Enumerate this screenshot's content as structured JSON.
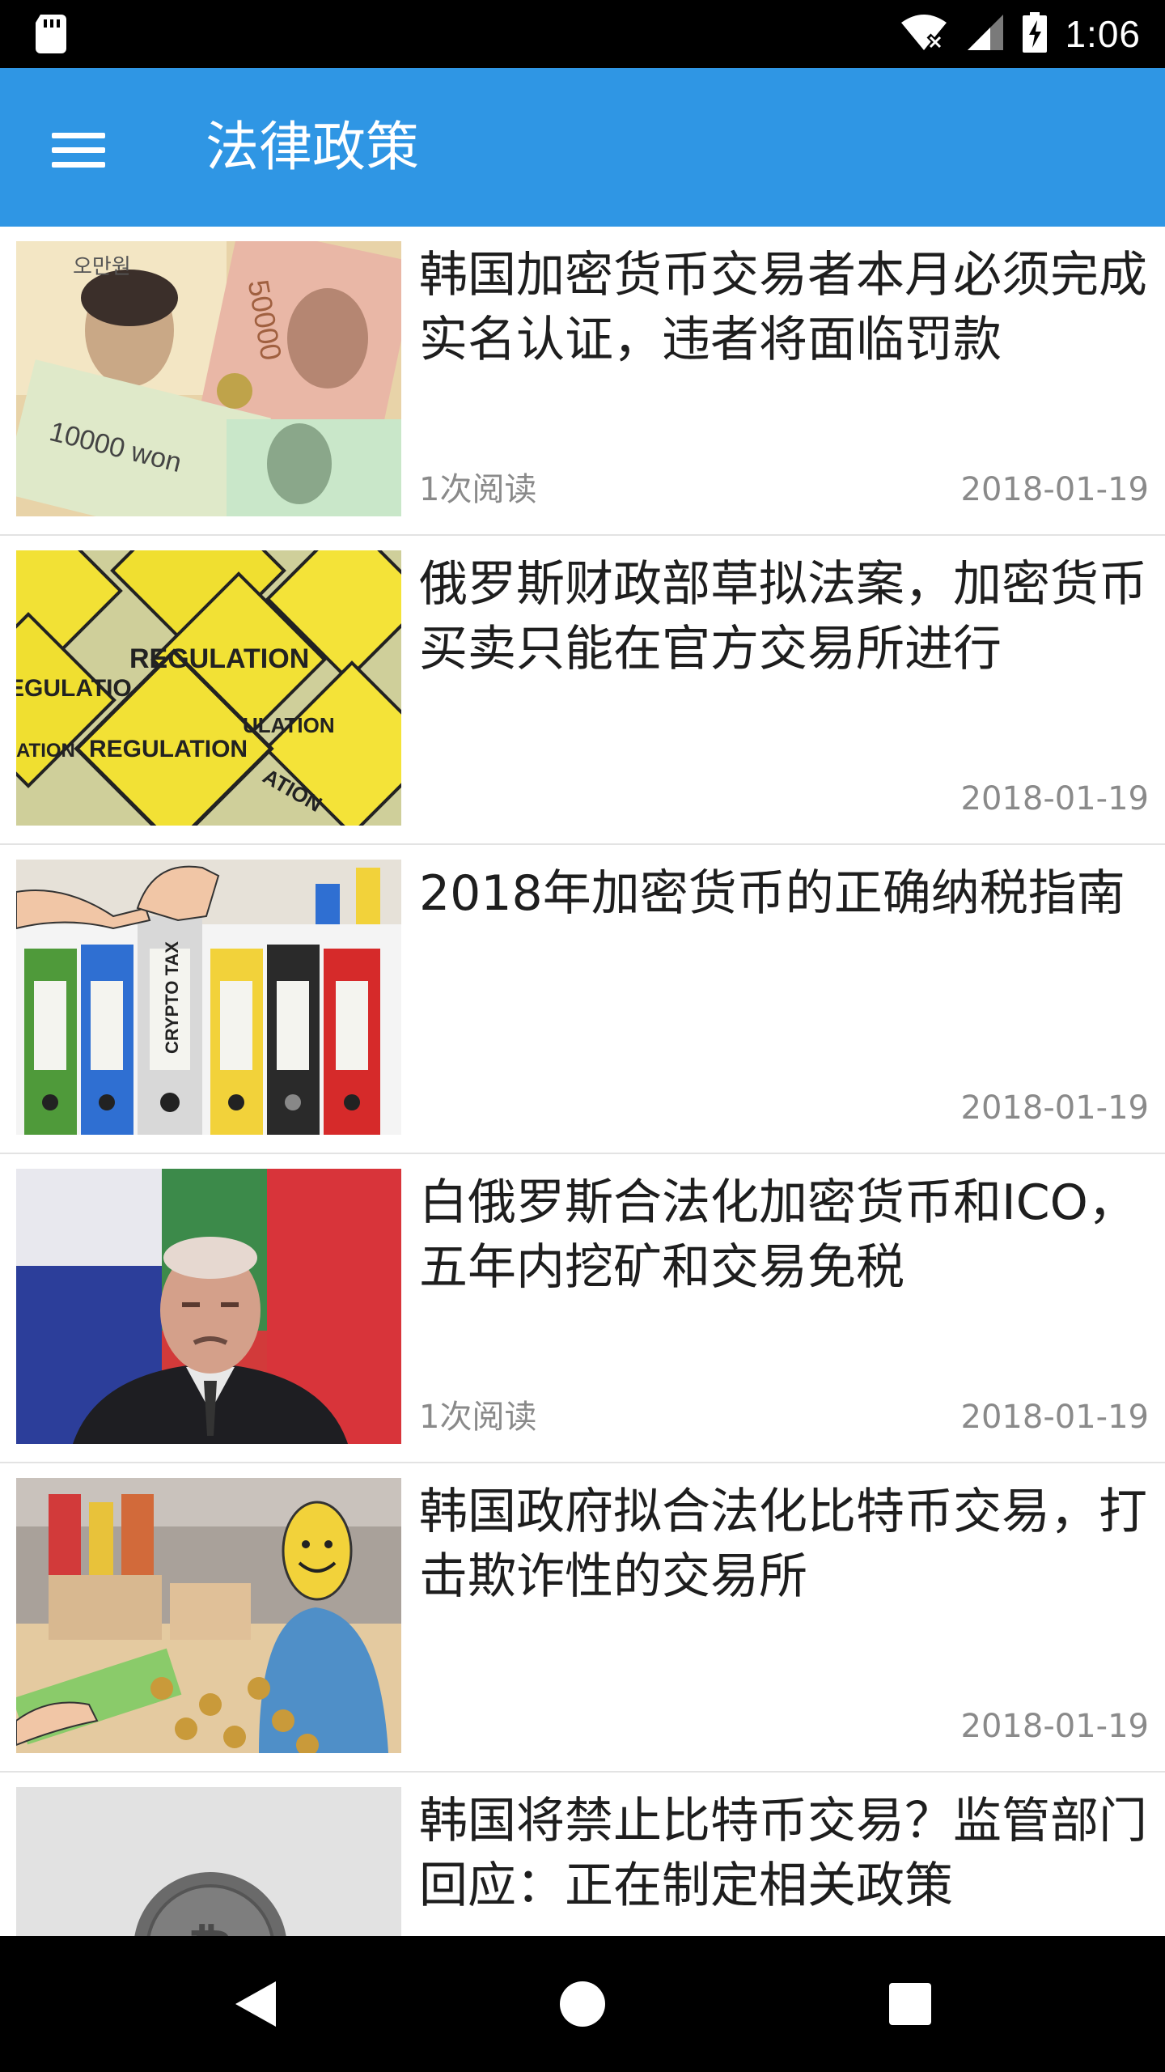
{
  "status_bar": {
    "time": "1:06",
    "icons": [
      "sd-card-icon",
      "wifi-off-icon",
      "signal-icon",
      "battery-charging-icon"
    ]
  },
  "app_bar": {
    "title": "法律政策",
    "menu_icon": "hamburger-menu-icon",
    "color": "#2f96e4"
  },
  "articles": [
    {
      "title": "韩国加密货币交易者本月必须完成实名认证，违者将面临罚款",
      "reads": "1次阅读",
      "date": "2018-01-19",
      "image": "korean-won-banknotes"
    },
    {
      "title": "俄罗斯财政部草拟法案，加密货币买卖只能在官方交易所进行",
      "reads": "",
      "date": "2018-01-19",
      "image": "regulation-road-signs"
    },
    {
      "title": "2018年加密货币的正确纳税指南",
      "reads": "",
      "date": "2018-01-19",
      "image": "crypto-tax-binders"
    },
    {
      "title": "白俄罗斯合法化加密货币和ICO，五年内挖矿和交易免税",
      "reads": "1次阅读",
      "date": "2018-01-19",
      "image": "belarus-president-portrait"
    },
    {
      "title": "韩国政府拟合法化比特币交易，打击欺诈性的交易所",
      "reads": "",
      "date": "2018-01-19",
      "image": "street-market-smiley-trader"
    },
    {
      "title": "韩国将禁止比特币交易？监管部门回应：正在制定相关政策",
      "reads": "",
      "date": "",
      "image": "bitcoin-coin-grayscale"
    }
  ],
  "nav_bar": {
    "buttons": [
      "back-icon",
      "home-icon",
      "recents-icon"
    ]
  }
}
